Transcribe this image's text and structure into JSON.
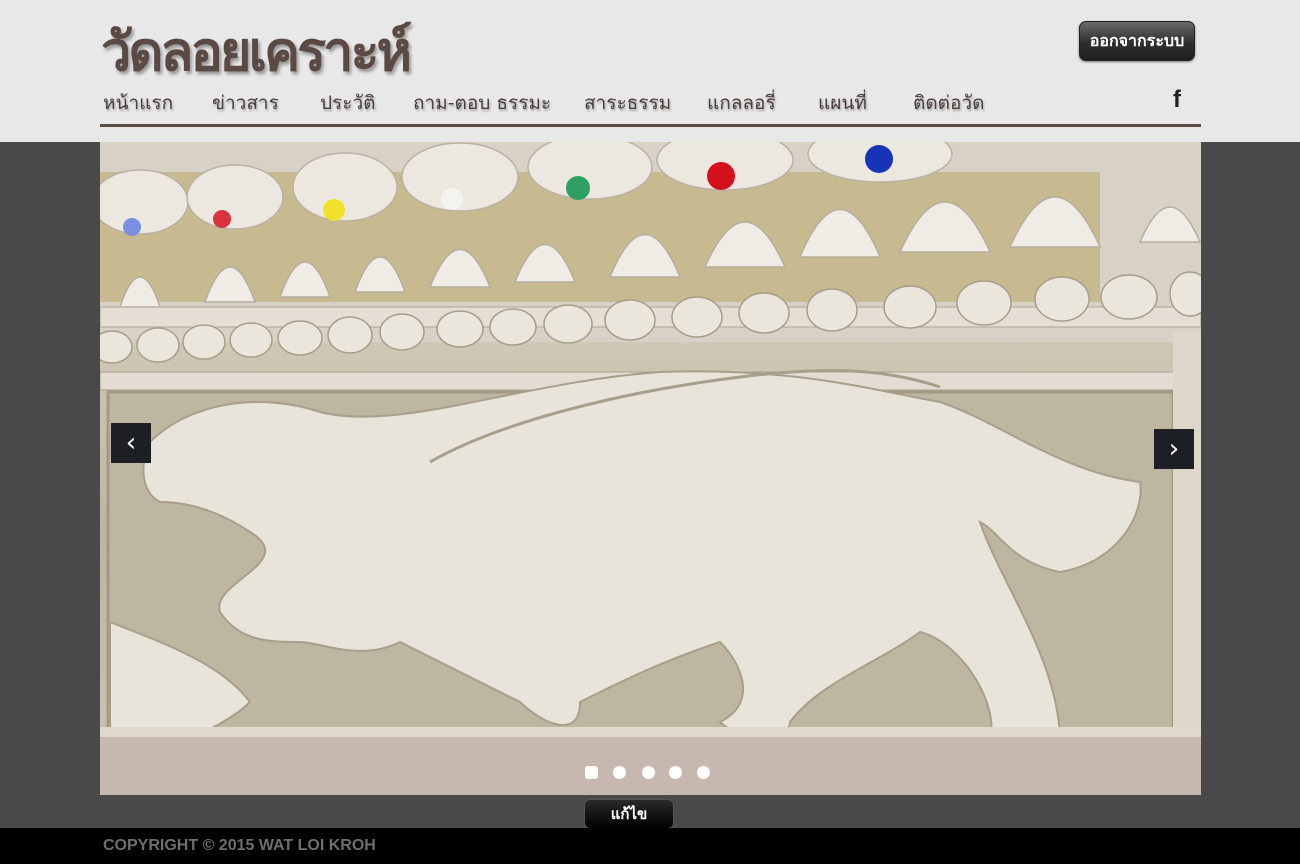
{
  "header": {
    "site_title": "วัดลอยเคราะห์",
    "logout_label": "ออกจากระบบ"
  },
  "nav": {
    "items": [
      {
        "label": "หน้าแรก"
      },
      {
        "label": "ข่าวสาร"
      },
      {
        "label": "ประวัติ"
      },
      {
        "label": "ถาม-ตอบ ธรรมะ"
      },
      {
        "label": "สาระธรรม"
      },
      {
        "label": "แกลลอรี่"
      },
      {
        "label": "แผนที่"
      },
      {
        "label": "ติดต่อวัด"
      }
    ],
    "social_icon": "facebook-icon",
    "social_glyph": "f"
  },
  "slider": {
    "image_subject": "stone relief carving of a mythical lion on a temple wall",
    "prev_glyph": "‹",
    "next_glyph": "›",
    "dot_count": 5,
    "active_dot": 1
  },
  "edit_label": "แก้ไข",
  "footer": {
    "copyright": "COPYRIGHT © 2015 WAT LOI KROH"
  },
  "colors": {
    "header_bg": "#e8e8e8",
    "brand": "#5b4a44",
    "page_bg": "#4a4949",
    "footer_bg": "#000000"
  }
}
